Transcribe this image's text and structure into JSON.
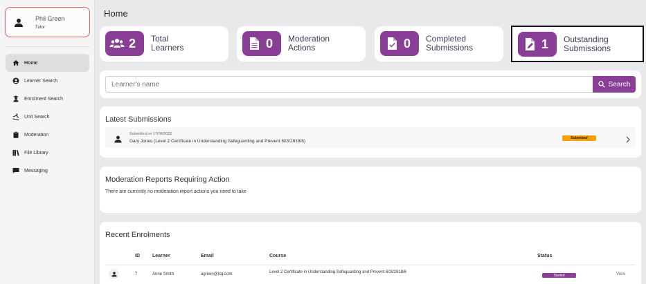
{
  "user": {
    "name": "Phil Green",
    "role": "Tutor"
  },
  "nav": {
    "items": [
      {
        "label": "Home",
        "icon": "home-icon"
      },
      {
        "label": "Learner Search",
        "icon": "user-circle-icon"
      },
      {
        "label": "Enrolment Search",
        "icon": "graduate-icon"
      },
      {
        "label": "Unit Search",
        "icon": "ski-icon"
      },
      {
        "label": "Moderation",
        "icon": "clipboard-icon"
      },
      {
        "label": "File Library",
        "icon": "books-icon"
      },
      {
        "label": "Messaging",
        "icon": "chat-icon"
      }
    ]
  },
  "page": {
    "title": "Home"
  },
  "stats": [
    {
      "value": "2",
      "label_line1": "Total",
      "label_line2": "Learners",
      "icon": "users-icon"
    },
    {
      "value": "0",
      "label_line1": "Moderation",
      "label_line2": "Actions",
      "icon": "document-icon"
    },
    {
      "value": "0",
      "label_line1": "Completed",
      "label_line2": "Submissions",
      "icon": "document-check-icon"
    },
    {
      "value": "1",
      "label_line1": "Outstanding",
      "label_line2": "Submissions",
      "icon": "document-edit-icon"
    }
  ],
  "search": {
    "placeholder": "Learner's name",
    "button_label": "Search"
  },
  "latest_submissions": {
    "title": "Latest Submissions",
    "items": [
      {
        "date": "Submitted on 17/06/2022",
        "title": "Gary Jones (Level 2 Certificate in Understanding Safeguarding and Prevent 603/2818/6)",
        "status": "Submitted"
      }
    ]
  },
  "moderation": {
    "title": "Moderation Reports Requiring Action",
    "empty_text": "There are currently no moderation report actions you need to take"
  },
  "enrolments": {
    "title": "Recent Enrolments",
    "columns": [
      "ID",
      "Learner",
      "Email",
      "Course",
      "Status"
    ],
    "rows": [
      {
        "id": "7",
        "learner": "Anne Smith",
        "email": "agreen@lcg.com",
        "course": "Level 2 Certificate in Understanding Safeguarding and Prevent 603/2818/6",
        "status": "Started",
        "action": "View"
      }
    ]
  },
  "colors": {
    "accent": "#8a3f97",
    "submitted": "#f5a007",
    "user_card_border": "#e45b5b"
  }
}
